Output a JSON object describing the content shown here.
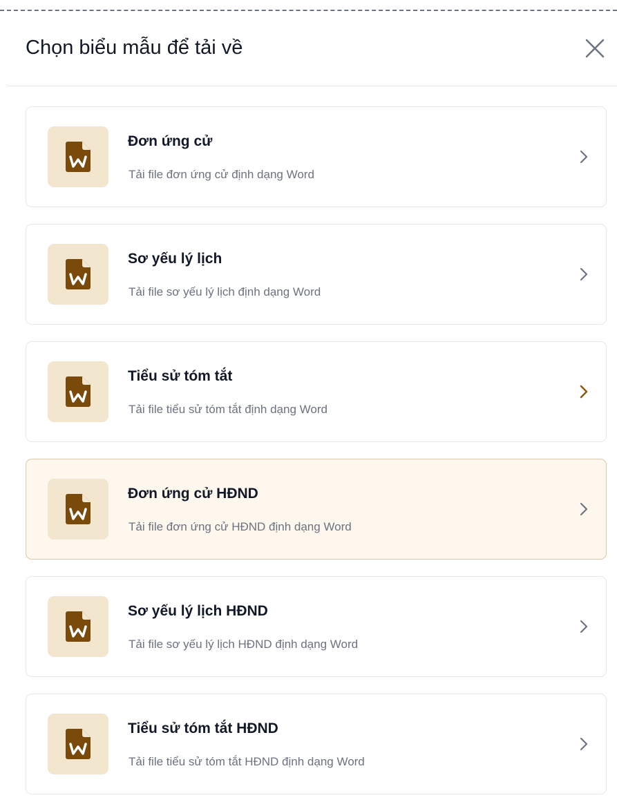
{
  "dialog": {
    "title": "Chọn biểu mẫu để tải về",
    "close_icon": "close-icon"
  },
  "items": [
    {
      "title": "Đơn ứng cử",
      "description": "Tải file đơn ứng cử định dạng Word",
      "icon": "word-file-icon",
      "highlighted": false
    },
    {
      "title": "Sơ yếu lý lịch",
      "description": "Tải file sơ yếu lý lịch định dạng Word",
      "icon": "word-file-icon",
      "highlighted": false
    },
    {
      "title": "Tiểu sử tóm tắt",
      "description": "Tải file tiểu sử tóm tắt định dạng Word",
      "icon": "word-file-icon",
      "highlighted": false
    },
    {
      "title": "Đơn ứng cử HĐND",
      "description": "Tải file đơn ứng cử HĐND định dạng Word",
      "icon": "word-file-icon",
      "highlighted": true
    },
    {
      "title": "Sơ yếu lý lịch HĐND",
      "description": "Tải file sơ yếu lý lịch HĐND định dạng Word",
      "icon": "word-file-icon",
      "highlighted": false
    },
    {
      "title": "Tiểu sử tóm tắt HĐND",
      "description": "Tải file tiểu sử tóm tắt HĐND định dạng Word",
      "icon": "word-file-icon",
      "highlighted": false
    }
  ],
  "colors": {
    "accent_brown": "#7a4a0b",
    "icon_bg": "#f3e6cf",
    "highlight_bg": "#fdf7ee",
    "highlight_border": "#dcc8a6",
    "chevron_active": "#8a5a0e",
    "chevron_default": "#6b7280"
  }
}
